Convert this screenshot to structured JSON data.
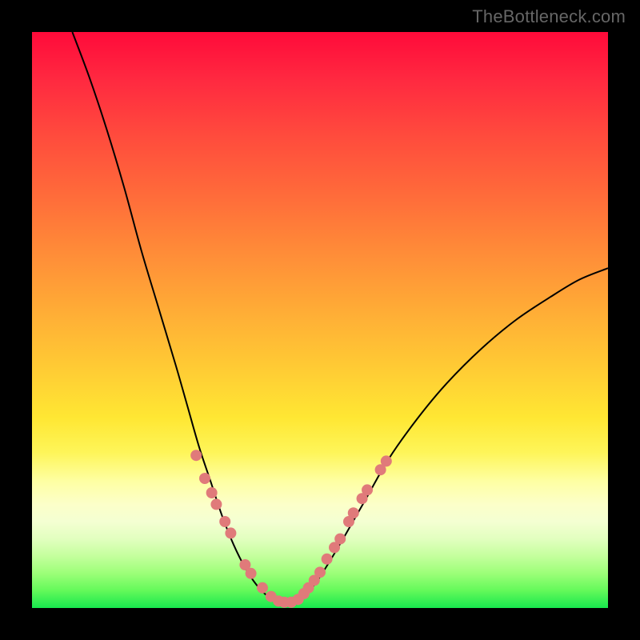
{
  "watermark": "TheBottleneck.com",
  "chart_data": {
    "type": "line",
    "title": "",
    "xlabel": "",
    "ylabel": "",
    "xlim": [
      0,
      1
    ],
    "ylim": [
      0,
      1
    ],
    "series": [
      {
        "name": "curve",
        "points": [
          {
            "x": 0.07,
            "y": 1.0
          },
          {
            "x": 0.1,
            "y": 0.92
          },
          {
            "x": 0.13,
            "y": 0.83
          },
          {
            "x": 0.16,
            "y": 0.73
          },
          {
            "x": 0.19,
            "y": 0.62
          },
          {
            "x": 0.22,
            "y": 0.52
          },
          {
            "x": 0.25,
            "y": 0.42
          },
          {
            "x": 0.27,
            "y": 0.35
          },
          {
            "x": 0.29,
            "y": 0.28
          },
          {
            "x": 0.31,
            "y": 0.22
          },
          {
            "x": 0.33,
            "y": 0.16
          },
          {
            "x": 0.35,
            "y": 0.11
          },
          {
            "x": 0.37,
            "y": 0.07
          },
          {
            "x": 0.39,
            "y": 0.04
          },
          {
            "x": 0.41,
            "y": 0.02
          },
          {
            "x": 0.43,
            "y": 0.01
          },
          {
            "x": 0.45,
            "y": 0.01
          },
          {
            "x": 0.47,
            "y": 0.02
          },
          {
            "x": 0.49,
            "y": 0.04
          },
          {
            "x": 0.51,
            "y": 0.07
          },
          {
            "x": 0.54,
            "y": 0.12
          },
          {
            "x": 0.58,
            "y": 0.19
          },
          {
            "x": 0.62,
            "y": 0.26
          },
          {
            "x": 0.67,
            "y": 0.33
          },
          {
            "x": 0.72,
            "y": 0.39
          },
          {
            "x": 0.78,
            "y": 0.45
          },
          {
            "x": 0.84,
            "y": 0.5
          },
          {
            "x": 0.9,
            "y": 0.54
          },
          {
            "x": 0.95,
            "y": 0.57
          },
          {
            "x": 1.0,
            "y": 0.59
          }
        ]
      }
    ],
    "markers": [
      {
        "x": 0.285,
        "y": 0.265
      },
      {
        "x": 0.3,
        "y": 0.225
      },
      {
        "x": 0.312,
        "y": 0.2
      },
      {
        "x": 0.32,
        "y": 0.18
      },
      {
        "x": 0.335,
        "y": 0.15
      },
      {
        "x": 0.345,
        "y": 0.13
      },
      {
        "x": 0.37,
        "y": 0.075
      },
      {
        "x": 0.38,
        "y": 0.06
      },
      {
        "x": 0.4,
        "y": 0.035
      },
      {
        "x": 0.415,
        "y": 0.02
      },
      {
        "x": 0.428,
        "y": 0.012
      },
      {
        "x": 0.438,
        "y": 0.01
      },
      {
        "x": 0.45,
        "y": 0.01
      },
      {
        "x": 0.462,
        "y": 0.015
      },
      {
        "x": 0.472,
        "y": 0.025
      },
      {
        "x": 0.48,
        "y": 0.035
      },
      {
        "x": 0.49,
        "y": 0.048
      },
      {
        "x": 0.5,
        "y": 0.062
      },
      {
        "x": 0.512,
        "y": 0.085
      },
      {
        "x": 0.525,
        "y": 0.105
      },
      {
        "x": 0.535,
        "y": 0.12
      },
      {
        "x": 0.55,
        "y": 0.15
      },
      {
        "x": 0.558,
        "y": 0.165
      },
      {
        "x": 0.573,
        "y": 0.19
      },
      {
        "x": 0.582,
        "y": 0.205
      },
      {
        "x": 0.605,
        "y": 0.24
      },
      {
        "x": 0.615,
        "y": 0.255
      }
    ],
    "bg_gradient": {
      "top": "#ff0a3a",
      "bottom": "#17e84e"
    }
  }
}
